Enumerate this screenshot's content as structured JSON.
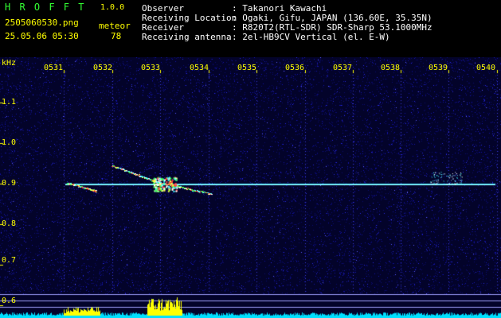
{
  "app": {
    "name": "H R O F F T",
    "version": "1.0.0"
  },
  "file": {
    "name": "2505060530.png",
    "datetime": "25.05.06 05:30"
  },
  "meteor": {
    "label": "meteor",
    "count": "78"
  },
  "info": [
    {
      "label": "Observer",
      "value": ": Takanori Kawachi"
    },
    {
      "label": "Receiving Location",
      "value": ": Ogaki, Gifu, JAPAN (136.60E, 35.35N)"
    },
    {
      "label": "Receiver",
      "value": ": R820T2(RTL-SDR) SDR-Sharp 53.1000MHz"
    },
    {
      "label": "Receiving antenna",
      "value": ": 2el-HB9CV Vertical (el. E-W)"
    }
  ],
  "axis": {
    "y_unit": "kHz",
    "x_ticks": [
      "0531",
      "0532",
      "0533",
      "0534",
      "0535",
      "0536",
      "0537",
      "0538",
      "0539",
      "0540"
    ],
    "y_ticks": [
      "1.1",
      "1.0",
      "0.9",
      "0.8",
      "0.7",
      "0.6"
    ]
  },
  "colors": {
    "background": "#000000",
    "noise": "#1a1ad0",
    "carrier": "#40e0ff",
    "axis_text": "#ffff00",
    "title": "#33ff33"
  }
}
